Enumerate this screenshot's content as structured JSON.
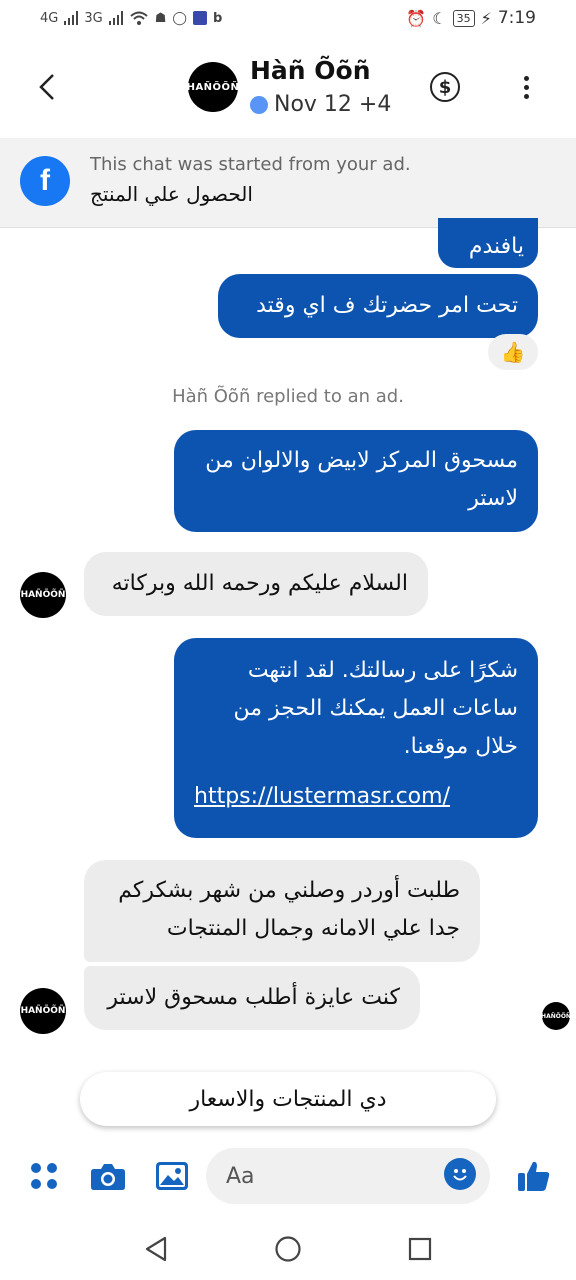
{
  "status_bar": {
    "network_1": "4G",
    "network_2": "3G",
    "app_letter": "b",
    "battery": "35",
    "time": "7:19"
  },
  "header": {
    "name": "Hàñ Õõñ",
    "status": "Nov 12 +4",
    "avatar_text": "HAÑÕÕÑ",
    "back_icon": "chevron-left-icon",
    "payment_icon": "dollar-circle-icon",
    "more_icon": "vertical-dots-icon"
  },
  "ad_banner": {
    "line1": "This chat was started from your ad.",
    "line2": "الحصول علي المنتج",
    "icon": "facebook-icon"
  },
  "messages": {
    "m1": "يافندم",
    "m2": "تحت امر حضرتك ف اي وقتد",
    "reaction": "👍",
    "system_note": "Hàñ Õõñ replied to an ad.",
    "m3_line1": "مسحوق المركز لابيض والالوان من",
    "m3_line2": "لاستر",
    "m4": "السلام عليكم ورحمه الله وبركاته",
    "m5_line1": "شكرًا على رسالتك. لقد انتهت",
    "m5_line2": "ساعات العمل يمكنك الحجز من",
    "m5_line3": "خلال موقعنا.",
    "m5_link": "https://lustermasr.com/",
    "m6_line1": "طلبت أوردر وصلني من شهر بشكركم",
    "m6_line2": "جدا علي الامانه وجمال المنتجات",
    "m7": "كنت عايزة أطلب مسحوق لاستر"
  },
  "quick_reply": "دي المنتجات والاسعار",
  "composer": {
    "placeholder": "Aa",
    "icons": [
      "menu-dots-icon",
      "camera-icon",
      "gallery-icon",
      "emoji-icon",
      "like-icon"
    ]
  },
  "navbar": {
    "icons": [
      "back-triangle-icon",
      "home-circle-icon",
      "recents-square-icon"
    ]
  },
  "colors": {
    "outgoing_bubble": "#0d54b0",
    "incoming_bubble": "#ececec",
    "accent": "#1565c0",
    "facebook": "#1877f2"
  }
}
